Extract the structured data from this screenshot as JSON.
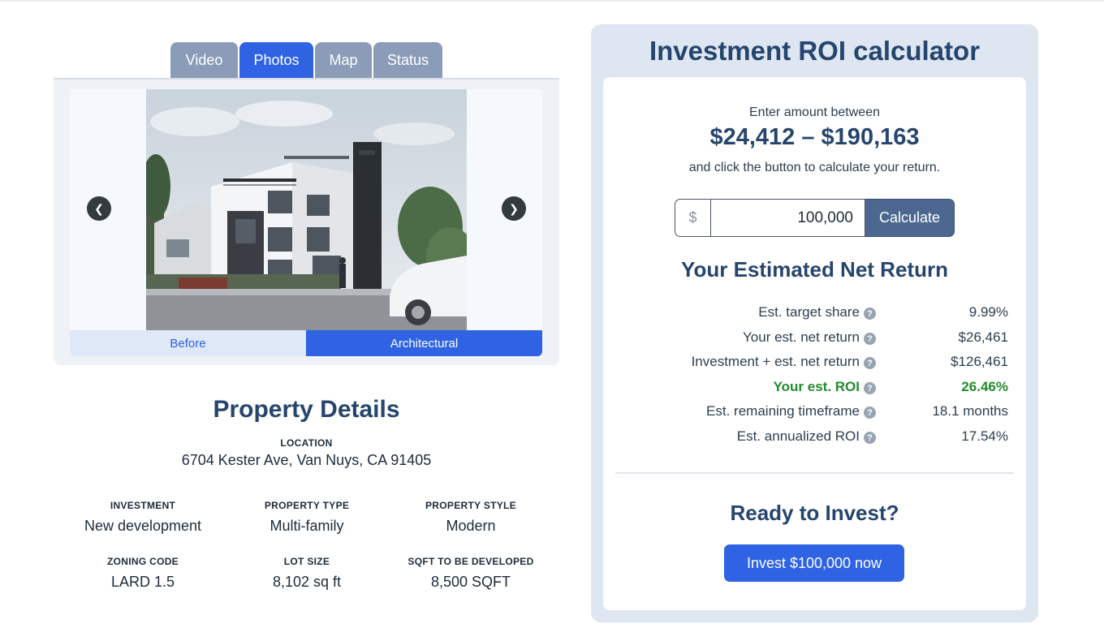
{
  "media": {
    "tabs": [
      {
        "label": "Video",
        "active": false
      },
      {
        "label": "Photos",
        "active": true
      },
      {
        "label": "Map",
        "active": false
      },
      {
        "label": "Status",
        "active": false
      }
    ],
    "photo_description": "Architectural rendering of a modern three-story white multi-family building",
    "toggle": {
      "before_label": "Before",
      "architectural_label": "Architectural",
      "selected": "Architectural"
    },
    "icons": {
      "prev": "chevron-left-icon",
      "next": "chevron-right-icon"
    }
  },
  "property_details": {
    "title": "Property Details",
    "location": {
      "label": "LOCATION",
      "value": "6704 Kester Ave, Van Nuys, CA 91405"
    },
    "items": [
      {
        "label": "INVESTMENT",
        "value": "New development"
      },
      {
        "label": "PROPERTY TYPE",
        "value": "Multi-family"
      },
      {
        "label": "PROPERTY STYLE",
        "value": "Modern"
      },
      {
        "label": "ZONING CODE",
        "value": "LARD 1.5"
      },
      {
        "label": "LOT SIZE",
        "value": "8,102 sq ft"
      },
      {
        "label": "SQFT TO BE DEVELOPED",
        "value": "8,500 SQFT"
      }
    ]
  },
  "roi": {
    "title": "Investment ROI calculator",
    "enter_text": "Enter amount between",
    "range": "$24,412 – $190,163",
    "instruction": "and click the button to calculate your return.",
    "currency_symbol": "$",
    "amount_value": "100,000",
    "calculate_label": "Calculate",
    "net_return_title": "Your Estimated Net Return",
    "rows": [
      {
        "label": "Est. target share",
        "value": "9.99%",
        "highlight": false
      },
      {
        "label": "Your est. net return",
        "value": "$26,461",
        "highlight": false
      },
      {
        "label": "Investment + est. net return",
        "value": "$126,461",
        "highlight": false
      },
      {
        "label": "Your est. ROI",
        "value": "26.46%",
        "highlight": true
      },
      {
        "label": "Est. remaining timeframe",
        "value": "18.1 months",
        "highlight": false
      },
      {
        "label": "Est. annualized ROI",
        "value": "17.54%",
        "highlight": false
      }
    ],
    "help_glyph": "?",
    "ready_title": "Ready to Invest?",
    "invest_label": "Invest $100,000 now"
  },
  "colors": {
    "primary_blue": "#2f63e3",
    "navy_heading": "#26456e",
    "inactive_tab": "#8a9cb8",
    "calculate_button": "#4d6890",
    "roi_highlight_green": "#238a2e",
    "panel_bg": "#dde6f1"
  }
}
